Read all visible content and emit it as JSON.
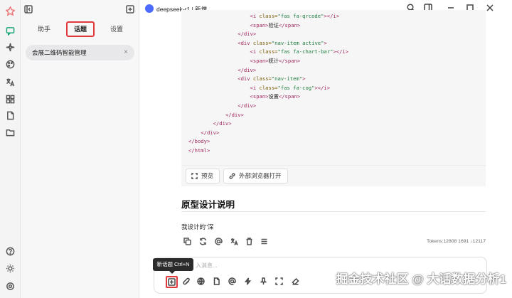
{
  "sidebar_tabs": {
    "assistant": "助手",
    "topics": "话题",
    "settings": "设置"
  },
  "topic_item": {
    "label": "会展二维码智能管理",
    "close": "×"
  },
  "header": {
    "model": "deepseek-r1 | 新增"
  },
  "code_lines": [
    [
      "                    ",
      "<i ",
      "class=",
      "\"fas fa-qrcode\"",
      "></i>",
      ""
    ],
    [
      "                    ",
      "<span>",
      "",
      "",
      "</span>",
      "验证"
    ],
    [
      "                ",
      "</div>",
      "",
      "",
      "",
      ""
    ],
    [
      "                ",
      "<div ",
      "class=",
      "\"nav-item active\"",
      ">",
      ""
    ],
    [
      "                    ",
      "<i ",
      "class=",
      "\"fas fa-chart-bar\"",
      "></i>",
      ""
    ],
    [
      "                    ",
      "<span>",
      "",
      "",
      "</span>",
      "统计"
    ],
    [
      "                ",
      "</div>",
      "",
      "",
      "",
      ""
    ],
    [
      "                ",
      "<div ",
      "class=",
      "\"nav-item\"",
      ">",
      ""
    ],
    [
      "                    ",
      "<i ",
      "class=",
      "\"fas fa-cog\"",
      "></i>",
      ""
    ],
    [
      "                    ",
      "<span>",
      "",
      "",
      "</span>",
      "设置"
    ],
    [
      "                ",
      "</div>",
      "",
      "",
      "",
      ""
    ],
    [
      "            ",
      "</div>",
      "",
      "",
      "",
      ""
    ],
    [
      "        ",
      "</div>",
      "",
      "",
      "",
      ""
    ],
    [
      "    ",
      "</div>",
      "",
      "",
      "",
      ""
    ],
    [
      "",
      "</body>",
      "",
      "",
      "",
      ""
    ],
    [
      "",
      "</html>",
      "",
      "",
      "",
      ""
    ]
  ],
  "code_buttons": {
    "preview": "预览",
    "open_external": "外部浏览器打开"
  },
  "message": {
    "heading": "原型设计说明",
    "paragraph": "我设计的\"深",
    "tokens": "Tokens:12808 1691 ↓12117"
  },
  "input": {
    "placeholder": "入消息...",
    "tooltip": "新话题 Ctrl+N"
  },
  "watermark": "掘金技术社区 @ 大话数据分析1",
  "colors": {
    "accent_green": "#1aa87a",
    "highlight_red": "#e0393e",
    "deepseek_blue": "#4d6bfe"
  }
}
